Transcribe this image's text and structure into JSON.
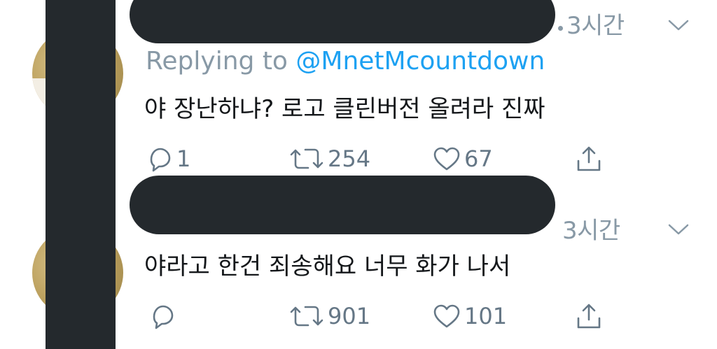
{
  "tweets": [
    {
      "time": "3시간",
      "replying_prefix": "Replying to ",
      "replying_handle": "@MnetMcountdown",
      "text": "야 장난하냐? 로고 클린버전 올려라 진짜",
      "stats": {
        "replies": "1",
        "retweets": "254",
        "likes": "67"
      }
    },
    {
      "time": "3시간",
      "text": "야라고 한건 죄송해요 너무 화가 나서",
      "stats": {
        "replies": "",
        "retweets": "901",
        "likes": "101"
      }
    }
  ],
  "icons": {
    "more": "chevron-down-icon",
    "reply": "reply-bubble-icon",
    "retweet": "retweet-icon",
    "like": "heart-icon",
    "share": "share-icon"
  },
  "colors": {
    "text": "#14171a",
    "muted": "#8899a6",
    "action": "#657786",
    "link": "#1da1f2",
    "redaction": "#24292d"
  }
}
